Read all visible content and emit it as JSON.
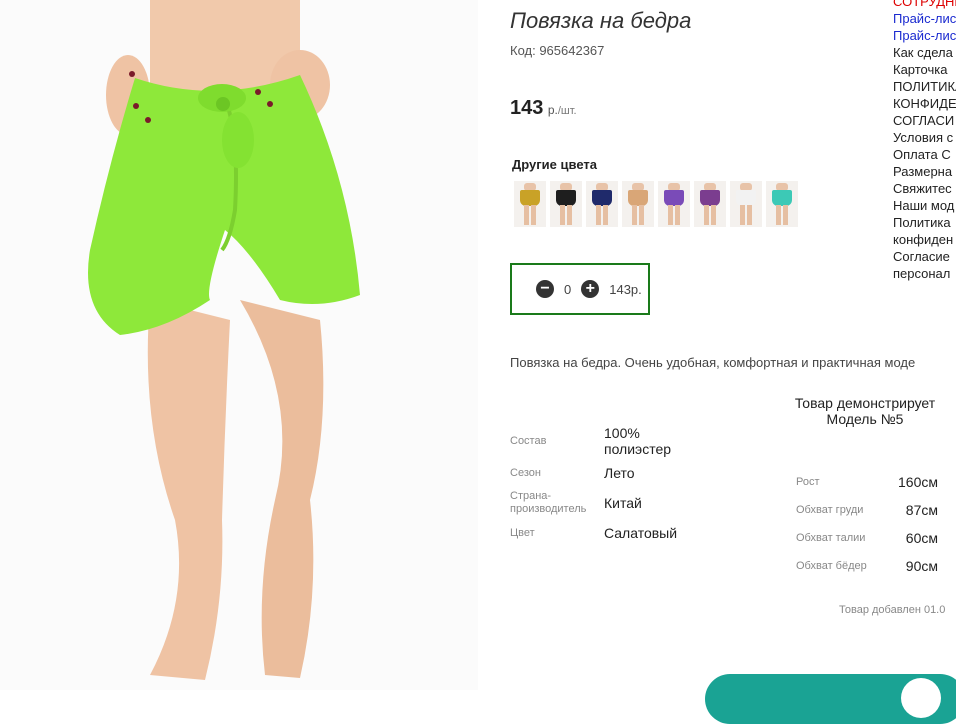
{
  "product": {
    "title": "Повязка на бедра",
    "code": "Код: 965642367",
    "price_value": "143",
    "price_unit": "р.",
    "price_per": "/шт."
  },
  "other_colors": {
    "heading": "Другие цвета",
    "swatches": [
      {
        "color": "#c9a227"
      },
      {
        "color": "#1e1e1e"
      },
      {
        "color": "#1f2a6b"
      },
      {
        "color": "#d9a677"
      },
      {
        "color": "#7a4bb8"
      },
      {
        "color": "#7b3d8f"
      },
      {
        "color": "#f2f2f2"
      },
      {
        "color": "#3cc9b6"
      }
    ]
  },
  "cart": {
    "minus_icon": "minus-circle-icon",
    "plus_icon": "plus-circle-icon",
    "quantity": "0",
    "sum": "143р."
  },
  "description": "Повязка на бедра. Очень удобная, комфортная и практичная моде",
  "specs": [
    {
      "label": "Состав",
      "value": "100% полиэстер"
    },
    {
      "label": "Сезон",
      "value": "Лето"
    },
    {
      "label": "Страна-производитель",
      "value": "Китай"
    },
    {
      "label": "Цвет",
      "value": "Салатовый"
    }
  ],
  "model": {
    "heading": "Товар демонстрирует Модель №5",
    "params": [
      {
        "label": "Рост",
        "value": "160см"
      },
      {
        "label": "Обхват груди",
        "value": "87см"
      },
      {
        "label": "Обхват талии",
        "value": "60см"
      },
      {
        "label": "Обхват бёдер",
        "value": "90см"
      }
    ]
  },
  "added_text": "Товар добавлен 01.0",
  "side_links": [
    {
      "text": "СОТРУДНИ",
      "style": "red"
    },
    {
      "text": "Прайс-лис",
      "style": "blue"
    },
    {
      "text": "Прайс-лис",
      "style": "blue"
    },
    {
      "text": "Как сдела",
      "style": "dark"
    },
    {
      "text": "Карточка",
      "style": "dark"
    },
    {
      "text": "ПОЛИТИКА",
      "style": "dark"
    },
    {
      "text": "КОНФИДЕ",
      "style": "dark"
    },
    {
      "text": "СОГЛАСИ",
      "style": "dark"
    },
    {
      "text": "Условия с",
      "style": "dark"
    },
    {
      "text": "Оплата С",
      "style": "dark"
    },
    {
      "text": "Размерна",
      "style": "dark"
    },
    {
      "text": "Свяжитес",
      "style": "dark"
    },
    {
      "text": "Наши мод",
      "style": "dark"
    },
    {
      "text": "Политика",
      "style": "dark"
    },
    {
      "text": "конфиден",
      "style": "dark"
    },
    {
      "text": "Согласие",
      "style": "dark"
    },
    {
      "text": "персонал",
      "style": "dark"
    }
  ],
  "colors": {
    "skirt": "#8ee83a",
    "skin": "#efc6a8",
    "accent_border": "#1a7a1a",
    "teal": "#1aa394"
  }
}
